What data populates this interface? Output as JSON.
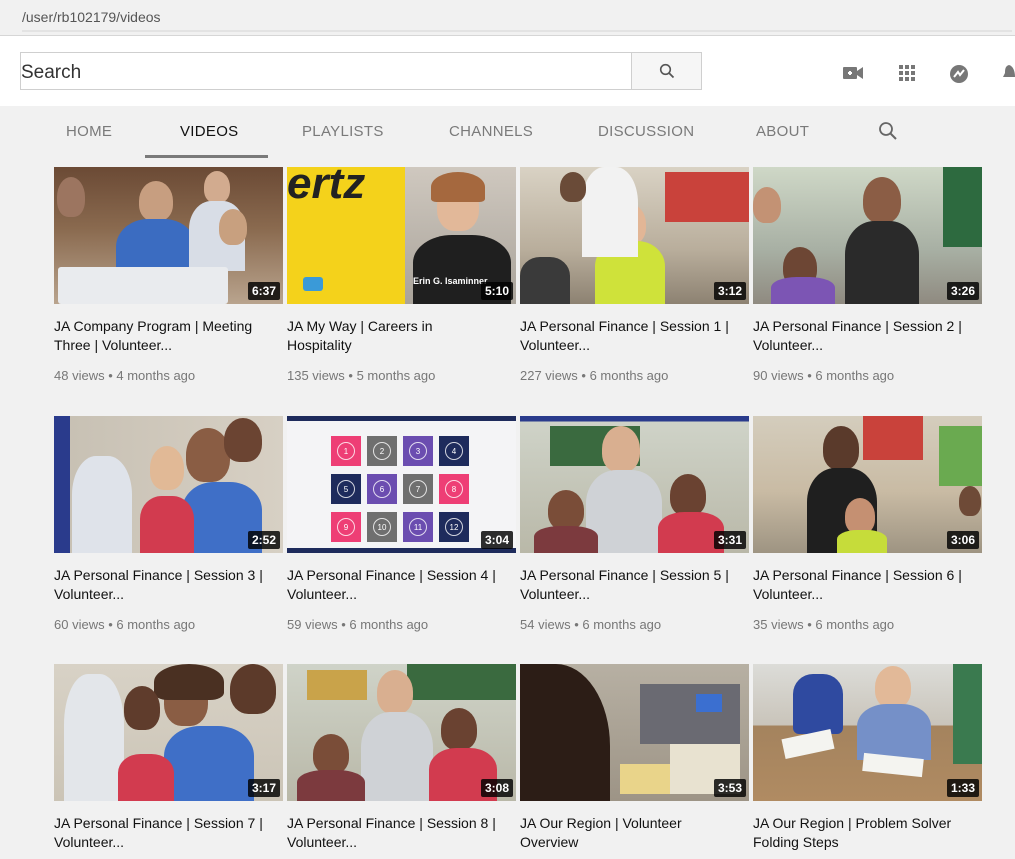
{
  "browser": {
    "url": "/user/rb102179/videos"
  },
  "masthead": {
    "search_placeholder": "Search",
    "icons": [
      "search-icon",
      "create-video-icon",
      "apps-grid-icon",
      "messages-icon",
      "notifications-icon"
    ]
  },
  "tabs": [
    {
      "label": "HOME"
    },
    {
      "label": "VIDEOS"
    },
    {
      "label": "PLAYLISTS"
    },
    {
      "label": "CHANNELS"
    },
    {
      "label": "DISCUSSION"
    },
    {
      "label": "ABOUT"
    }
  ],
  "active_tab": "VIDEOS",
  "videos": [
    {
      "title": "JA Company Program | Meeting Three | Volunteer...",
      "duration": "6:37",
      "views": "48 views",
      "age": "4 months ago"
    },
    {
      "title": "JA My Way | Careers in Hospitality",
      "duration": "5:10",
      "views": "135 views",
      "age": "5 months ago",
      "thumb_text": "ertz",
      "thumb_caption": "Erin G. Isaminner"
    },
    {
      "title": "JA Personal Finance | Session 1 | Volunteer...",
      "duration": "3:12",
      "views": "227 views",
      "age": "6 months ago"
    },
    {
      "title": "JA Personal Finance | Session 2 | Volunteer...",
      "duration": "3:26",
      "views": "90 views",
      "age": "6 months ago"
    },
    {
      "title": "JA Personal Finance | Session 3 | Volunteer...",
      "duration": "2:52",
      "views": "60 views",
      "age": "6 months ago"
    },
    {
      "title": "JA Personal Finance | Session 4 | Volunteer...",
      "duration": "3:04",
      "views": "59 views",
      "age": "6 months ago",
      "tile_numbers": [
        "1",
        "2",
        "3",
        "4",
        "5",
        "6",
        "7",
        "8",
        "9",
        "10",
        "11",
        "12"
      ]
    },
    {
      "title": "JA Personal Finance | Session 5 | Volunteer...",
      "duration": "3:31",
      "views": "54 views",
      "age": "6 months ago"
    },
    {
      "title": "JA Personal Finance | Session 6 | Volunteer...",
      "duration": "3:06",
      "views": "35 views",
      "age": "6 months ago"
    },
    {
      "title": "JA Personal Finance | Session 7 | Volunteer...",
      "duration": "3:17"
    },
    {
      "title": "JA Personal Finance | Session 8 | Volunteer...",
      "duration": "3:08"
    },
    {
      "title": "JA Our Region | Volunteer Overview",
      "duration": "3:53"
    },
    {
      "title": "JA Our Region | Problem Solver Folding Steps",
      "duration": "1:33"
    }
  ],
  "colors": {
    "page_bg": "#f1f1f1",
    "meta_text": "#777777",
    "hertz_yellow": "#f4d21b",
    "tile_pink": "#ee3e75",
    "tile_navy": "#1e2b5c",
    "tile_purple": "#6b4db0",
    "tile_gray": "#6f6f6f"
  }
}
